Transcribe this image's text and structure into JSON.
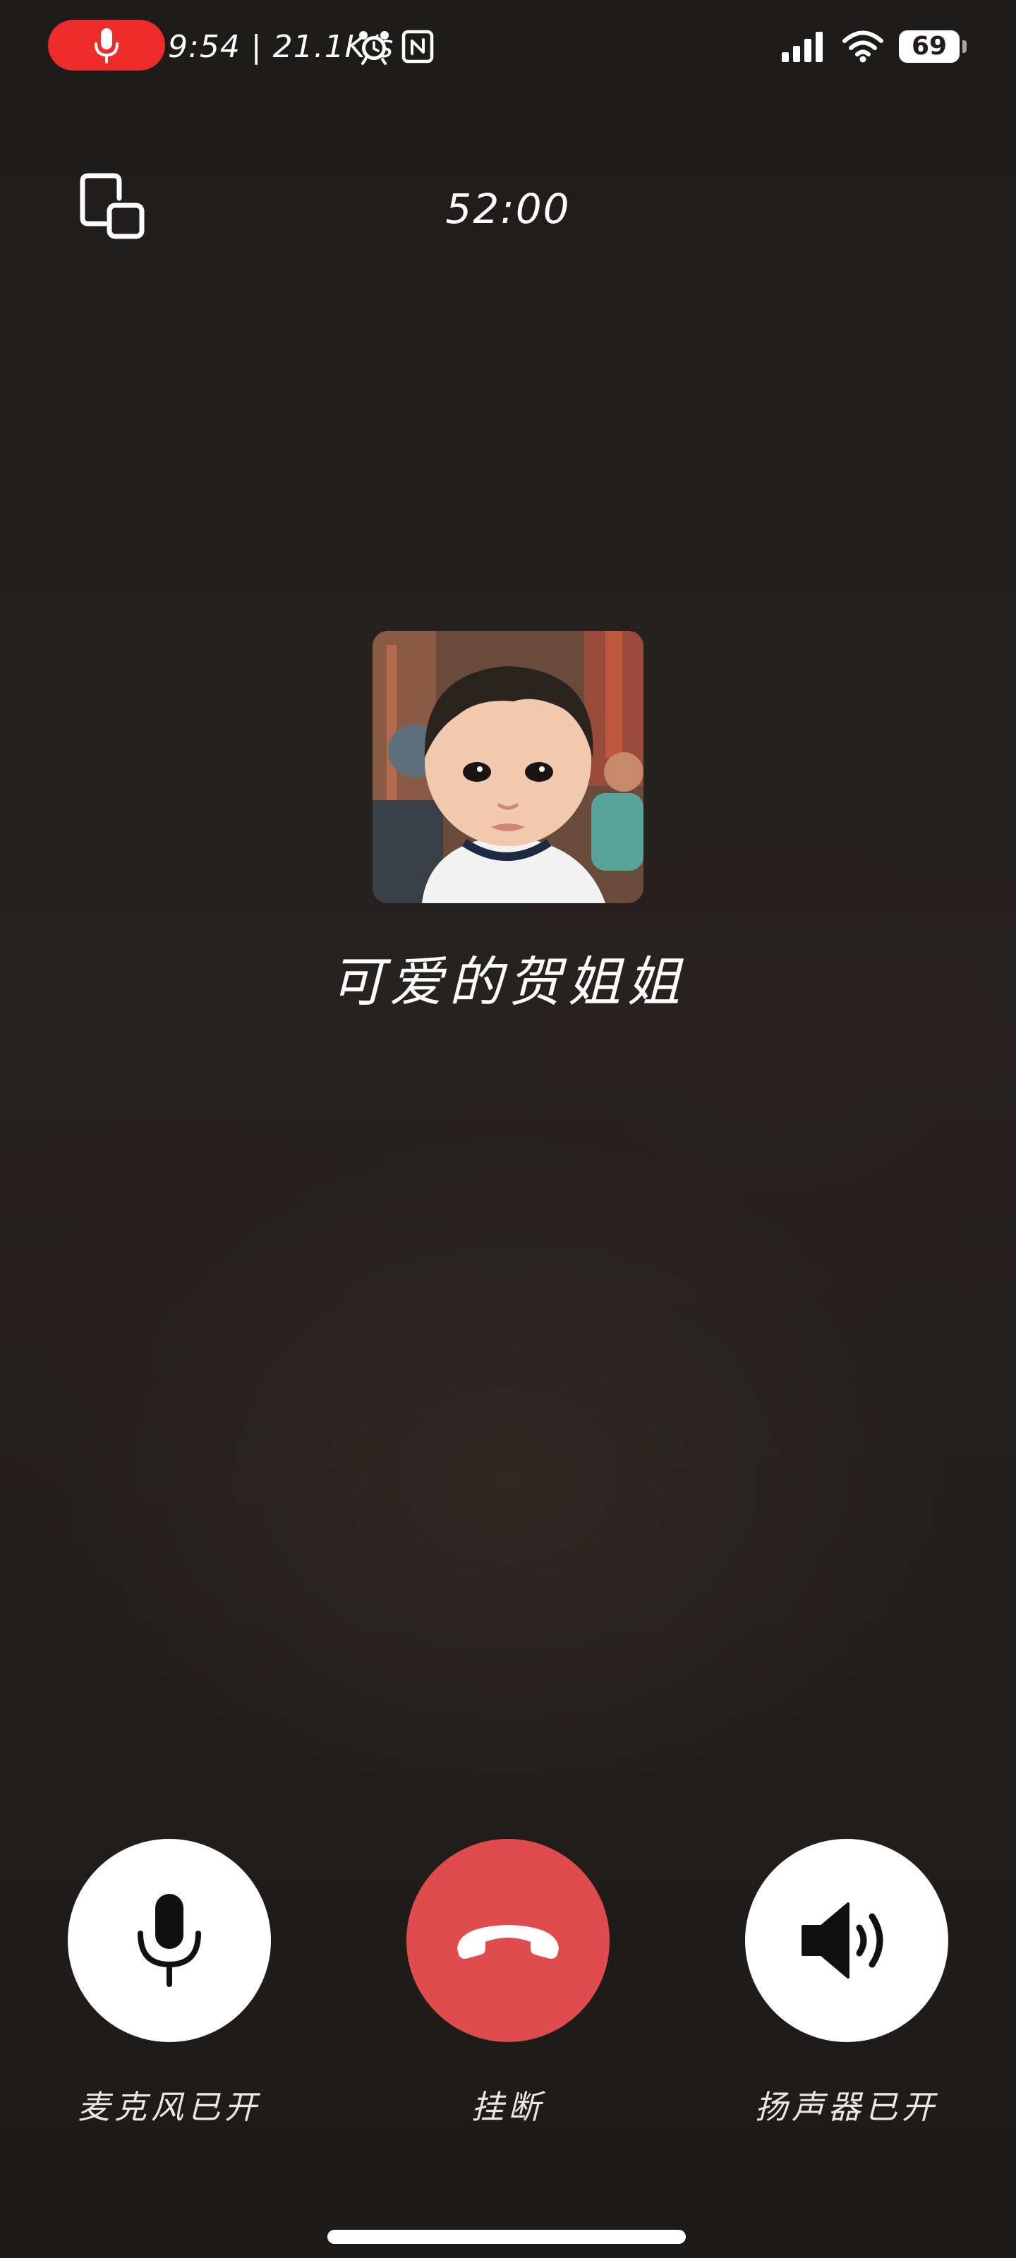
{
  "status_bar": {
    "recording_icon": "microphone-recording-icon",
    "time_speed": "9:54 | 21.1K/s",
    "alarm_icon": "alarm-clock-icon",
    "nfc_icon": "nfc-icon",
    "signal_icon": "cellular-signal-icon",
    "wifi_icon": "wifi-icon",
    "battery_level": "69",
    "recording_color": "#ee2b2b"
  },
  "call": {
    "minimize_icon": "floating-window-icon",
    "timer": "52:00",
    "contact_name": "可爱的贺姐姐",
    "avatar_icon": "contact-avatar-photo"
  },
  "controls": {
    "mic": {
      "label": "麦克风已开",
      "icon": "microphone-icon"
    },
    "hangup": {
      "label": "挂断",
      "icon": "hang-up-phone-icon",
      "color": "#e04b4e"
    },
    "speaker": {
      "label": "扬声器已开",
      "icon": "speaker-icon"
    }
  }
}
